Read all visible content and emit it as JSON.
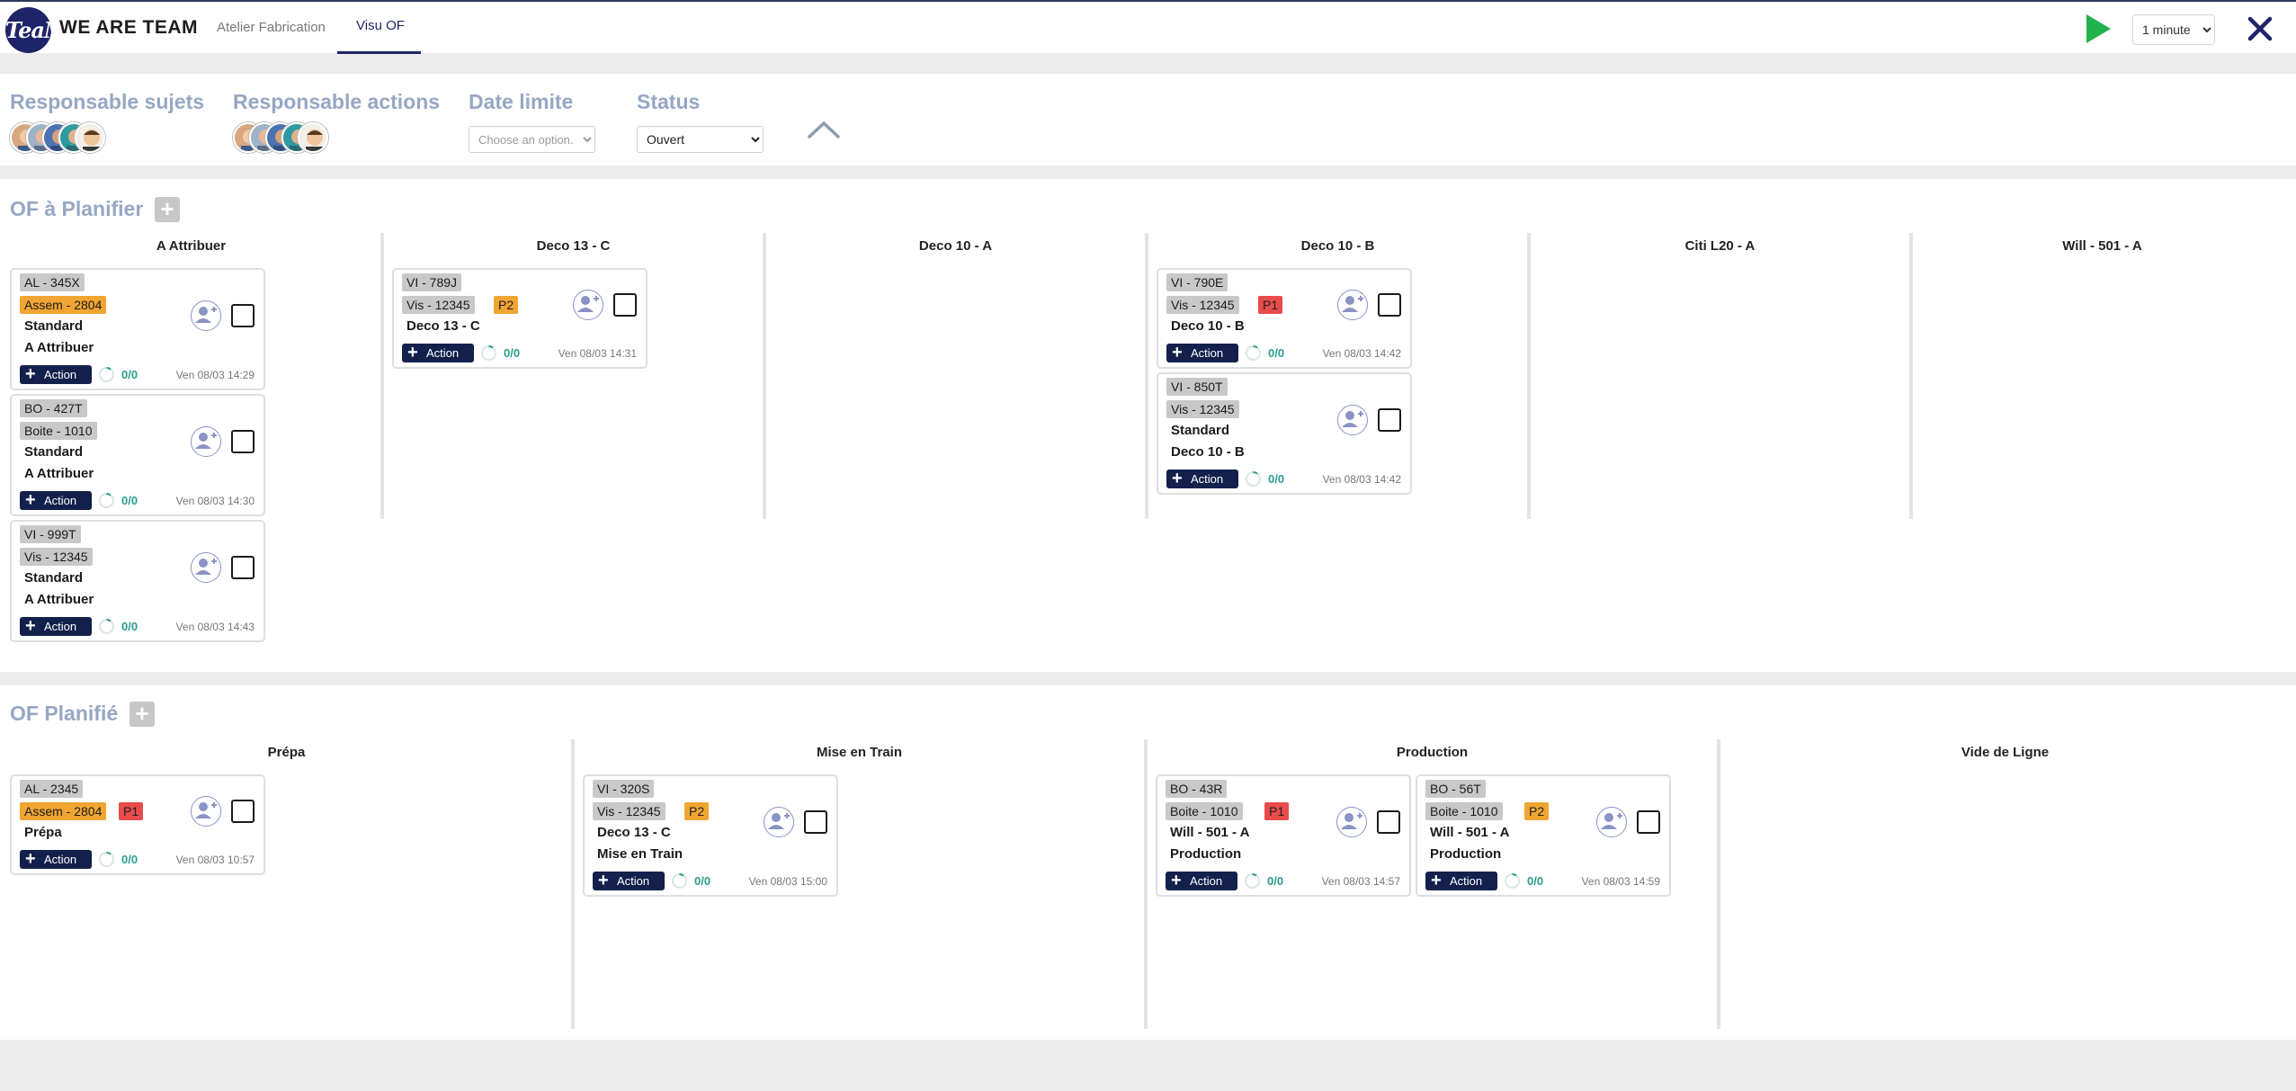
{
  "header": {
    "logo_text": "TeaM",
    "brand": "WE ARE TEAM",
    "tabs": [
      {
        "label": "Atelier Fabrication",
        "active": false
      },
      {
        "label": "Visu OF",
        "active": true
      }
    ],
    "refresh_interval": "1 minute",
    "colors": {
      "brand": "#1d2468",
      "play": "#22b24c"
    }
  },
  "filters": {
    "responsable_sujets": {
      "label": "Responsable sujets"
    },
    "responsable_actions": {
      "label": "Responsable actions"
    },
    "date_limite": {
      "label": "Date limite",
      "placeholder": "Choose an option..."
    },
    "status": {
      "label": "Status",
      "value": "Ouvert"
    }
  },
  "planifier": {
    "title": "OF à Planifier",
    "columns": [
      {
        "name": "A Attribuer",
        "cards": [
          {
            "tags": [
              "AL - 345X",
              "Assem - 2804"
            ],
            "prio": "",
            "lines": [
              "Standard",
              "A Attribuer"
            ],
            "action": "Action",
            "progress": "0/0",
            "date": "Ven 08/03 14:29"
          },
          {
            "tags": [
              "BO - 427T",
              "Boite - 1010"
            ],
            "prio": "",
            "lines": [
              "Standard",
              "A Attribuer"
            ],
            "action": "Action",
            "progress": "0/0",
            "date": "Ven 08/03 14:30"
          },
          {
            "tags": [
              "VI - 999T",
              "Vis - 12345"
            ],
            "prio": "",
            "lines": [
              "Standard",
              "A Attribuer"
            ],
            "action": "Action",
            "progress": "0/0",
            "date": "Ven 08/03 14:43"
          }
        ]
      },
      {
        "name": "Deco 13 - C",
        "cards": [
          {
            "tags": [
              "VI - 789J",
              "Vis - 12345"
            ],
            "prio": "P2",
            "lines": [
              "Deco 13 - C"
            ],
            "action": "Action",
            "progress": "0/0",
            "date": "Ven 08/03 14:31"
          }
        ]
      },
      {
        "name": "Deco 10 - A",
        "cards": []
      },
      {
        "name": "Deco 10 - B",
        "cards": [
          {
            "tags": [
              "VI - 790E",
              "Vis - 12345"
            ],
            "prio": "P1",
            "lines": [
              "Deco 10 - B"
            ],
            "action": "Action",
            "progress": "0/0",
            "date": "Ven 08/03 14:42"
          },
          {
            "tags": [
              "VI - 850T",
              "Vis - 12345"
            ],
            "prio": "",
            "lines": [
              "Standard",
              "Deco 10 - B"
            ],
            "action": "Action",
            "progress": "0/0",
            "date": "Ven 08/03 14:42"
          }
        ]
      },
      {
        "name": "Citi L20 - A",
        "cards": []
      },
      {
        "name": "Will - 501 - A",
        "cards": []
      }
    ]
  },
  "planifie": {
    "title": "OF Planifié",
    "columns": [
      {
        "name": "Prépa",
        "cards": [
          {
            "tags": [
              "AL - 2345",
              "Assem - 2804"
            ],
            "prio": "P1",
            "lines": [
              "Prépa"
            ],
            "action": "Action",
            "progress": "0/0",
            "date": "Ven 08/03 10:57"
          }
        ]
      },
      {
        "name": "Mise en Train",
        "cards": [
          {
            "tags": [
              "VI - 320S",
              "Vis - 12345"
            ],
            "prio": "P2",
            "lines": [
              "Deco 13 - C",
              "Mise en Train"
            ],
            "action": "Action",
            "progress": "0/0",
            "date": "Ven 08/03 15:00"
          }
        ]
      },
      {
        "name": "Production",
        "cards": [
          {
            "tags": [
              "BO - 43R",
              "Boite - 1010"
            ],
            "prio": "P1",
            "lines": [
              "Will - 501 - A",
              "Production"
            ],
            "action": "Action",
            "progress": "0/0",
            "date": "Ven 08/03 14:57"
          },
          {
            "tags": [
              "BO - 56T",
              "Boite - 1010"
            ],
            "prio": "P2",
            "lines": [
              "Will - 501 - A",
              "Production"
            ],
            "action": "Action",
            "progress": "0/0",
            "date": "Ven 08/03 14:59"
          }
        ]
      },
      {
        "name": "Vide de Ligne",
        "cards": []
      }
    ]
  }
}
